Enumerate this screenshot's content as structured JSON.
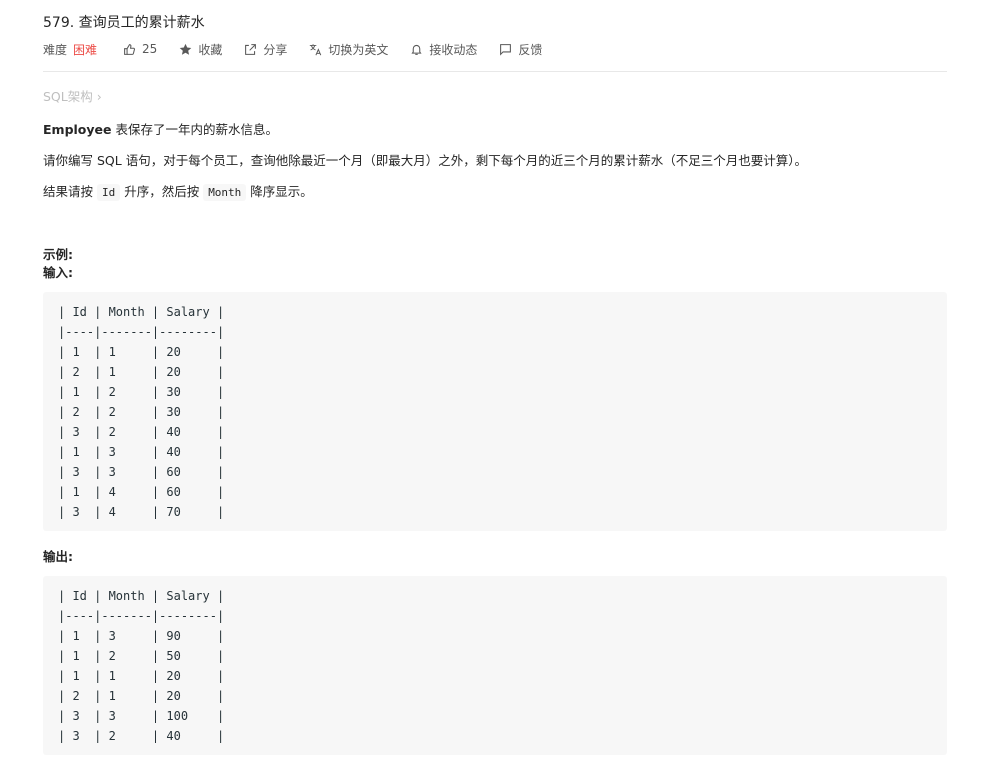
{
  "problem": {
    "title": "579. 查询员工的累计薪水"
  },
  "meta": {
    "difficulty_label": "难度",
    "difficulty_value": "困难",
    "likes": "25",
    "favorite": "收藏",
    "share": "分享",
    "switch_lang": "切换为英文",
    "subscribe": "接收动态",
    "feedback": "反馈"
  },
  "schema_link": "SQL架构 ›",
  "description": {
    "p1_bold": "Employee",
    "p1_rest": " 表保存了一年内的薪水信息。",
    "p2_a": "请你编写 ",
    "p2_b": "SQL",
    "p2_c": " 语句，对于每个员工，查询他除最近一个月（即最大月）之外，剩下每个月的近三个月的累计薪水（不足三个月也要计算）。",
    "p3_a": "结果请按 ",
    "p3_code1": "Id",
    "p3_b": " 升序，然后按 ",
    "p3_code2": "Month",
    "p3_c": " 降序显示。"
  },
  "example": {
    "example_label": "示例:",
    "input_label": "输入:",
    "output_label": "输出:",
    "input_rows": [
      "| Id | Month | Salary |",
      "|----|-------|--------|",
      "| 1  | 1     | 20     |",
      "| 2  | 1     | 20     |",
      "| 1  | 2     | 30     |",
      "| 2  | 2     | 30     |",
      "| 3  | 2     | 40     |",
      "| 1  | 3     | 40     |",
      "| 3  | 3     | 60     |",
      "| 1  | 4     | 60     |",
      "| 3  | 4     | 70     |"
    ],
    "output_rows": [
      "| Id | Month | Salary |",
      "|----|-------|--------|",
      "| 1  | 3     | 90     |",
      "| 1  | 2     | 50     |",
      "| 1  | 1     | 20     |",
      "| 2  | 1     | 20     |",
      "| 3  | 3     | 100    |",
      "| 3  | 2     | 40     |"
    ]
  },
  "icons": {
    "like": "thumbs-up-icon",
    "favorite": "star-icon",
    "share": "share-icon",
    "translate": "translate-icon",
    "bell": "bell-icon",
    "feedback": "flag-icon"
  },
  "colors": {
    "difficulty_hard": "#ec4c47",
    "muted": "#bfbfbf",
    "code_bg": "#f7f7f7"
  }
}
